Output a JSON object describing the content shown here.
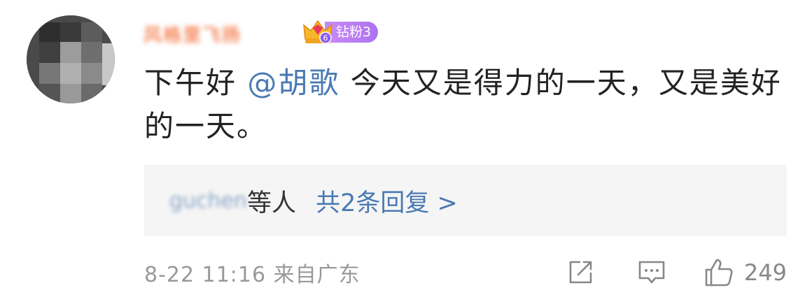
{
  "comment": {
    "username": "风格里飞扬",
    "badge_label": "钻粉3",
    "badge_level": "6",
    "text_before": "下午好 ",
    "mention": "@胡歌",
    "text_after": " 今天又是得力的一天，又是美好的一天。"
  },
  "replies": {
    "users_blurred": "guchen",
    "users_suffix": "等人",
    "count_label": "共2条回复 >"
  },
  "footer": {
    "meta": "8-22 11:16 来自广东",
    "like_count": "249"
  },
  "colors": {
    "link": "#4a7ab3",
    "badge": "#b97af3",
    "meta": "#999999"
  }
}
